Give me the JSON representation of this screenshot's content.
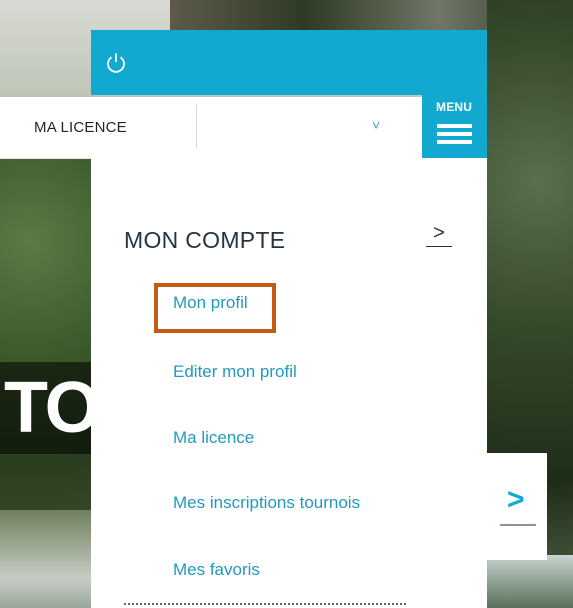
{
  "license_bar": {
    "label": "MA LICENCE",
    "chevron": "˅"
  },
  "menu_button": {
    "label": "MENU"
  },
  "hero": {
    "text": "TOU"
  },
  "account_menu": {
    "title": "MON COMPTE",
    "arrow": ">",
    "links": [
      {
        "label": "Mon profil"
      },
      {
        "label": "Editer mon profil"
      },
      {
        "label": "Ma licence"
      },
      {
        "label": "Mes inscriptions tournois"
      },
      {
        "label": "Mes favoris"
      }
    ]
  },
  "slider_next": {
    "arrow": ">"
  },
  "colors": {
    "accent": "#11a9cf",
    "link": "#2399bf",
    "highlight": "#c75a14"
  }
}
